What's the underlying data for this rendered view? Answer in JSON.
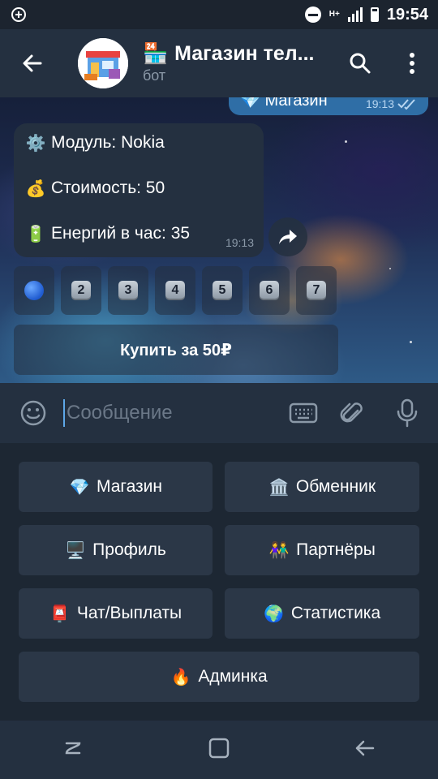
{
  "status_bar": {
    "time": "19:54",
    "network": "H+",
    "icons": [
      "add-circle-icon",
      "do-not-disturb-icon",
      "signal-icon",
      "battery-icon"
    ]
  },
  "header": {
    "title": "Магазин тел...",
    "subtitle": "бот",
    "title_emoji": "🏪",
    "icons": [
      "back-arrow-icon",
      "search-icon",
      "more-vertical-icon"
    ]
  },
  "chat": {
    "outgoing": {
      "text": "💎 Магазин",
      "time": "19:13",
      "status": "read"
    },
    "incoming": {
      "lines": [
        {
          "emoji": "⚙️",
          "text": "Модуль: Nokia"
        },
        {
          "emoji": "💰",
          "text": "Стоимость: 50"
        },
        {
          "emoji": "🔋",
          "text": "Енергий в час: 35"
        }
      ],
      "time": "19:13"
    },
    "inline_keyboard": [
      "●",
      "2",
      "3",
      "4",
      "5",
      "6",
      "7"
    ],
    "buy_button": "Купить за 50₽"
  },
  "input": {
    "placeholder": "Сообщение",
    "icons": [
      "emoji-icon",
      "keyboard-icon",
      "attach-icon",
      "microphone-icon"
    ]
  },
  "reply_keyboard": {
    "buttons": [
      {
        "emoji": "💎",
        "label": "Магазин"
      },
      {
        "emoji": "🏛️",
        "label": "Обменник"
      },
      {
        "emoji": "🖥️",
        "label": "Профиль"
      },
      {
        "emoji": "👫",
        "label": "Партнёры"
      },
      {
        "emoji": "📮",
        "label": "Чат/Выплаты"
      },
      {
        "emoji": "🌍",
        "label": "Статистика"
      },
      {
        "emoji": "🔥",
        "label": "Админка"
      }
    ]
  },
  "nav_bar": {
    "icons": [
      "recent-apps-icon",
      "home-icon",
      "back-icon"
    ]
  },
  "colors": {
    "header": "#243040",
    "background": "#1d2733",
    "accent": "#5ea7e8",
    "outgoing_bubble": "#2f6ea6"
  }
}
